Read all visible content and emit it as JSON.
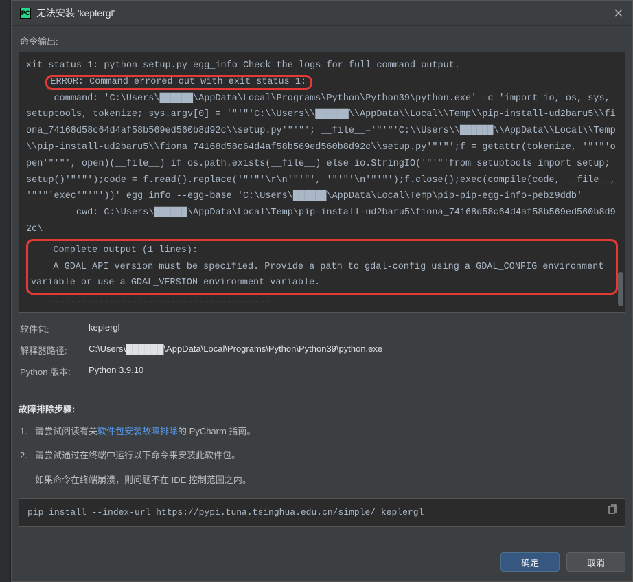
{
  "titlebar": {
    "app_icon_text": "PC",
    "title": "无法安装 'keplergl'"
  },
  "output_label": "命令输出:",
  "cmd": {
    "line1": "xit status 1: python setup.py egg_info Check the logs for full command output.",
    "error_line": "ERROR: Command errored out with exit status 1:",
    "command_block": "     command: 'C:\\Users\\██████\\AppData\\Local\\Programs\\Python\\Python39\\python.exe' -c 'import io, os, sys, setuptools, tokenize; sys.argv[0] = '\"'\"'C:\\\\Users\\\\██████\\\\AppData\\\\Local\\\\Temp\\\\pip-install-ud2baru5\\\\fiona_74168d58c64d4af58b569ed560b8d92c\\\\setup.py'\"'\"'; __file__='\"'\"'C:\\\\Users\\\\██████\\\\AppData\\\\Local\\\\Temp\\\\pip-install-ud2baru5\\\\fiona_74168d58c64d4af58b569ed560b8d92c\\\\setup.py'\"'\"';f = getattr(tokenize, '\"'\"'open'\"'\"', open)(__file__) if os.path.exists(__file__) else io.StringIO('\"'\"'from setuptools import setup; setup()'\"'\"');code = f.read().replace('\"'\"'\\r\\n'\"'\"', '\"'\"'\\n'\"'\"');f.close();exec(compile(code, __file__, '\"'\"'exec'\"'\"'))' egg_info --egg-base 'C:\\Users\\██████\\AppData\\Local\\Temp\\pip-pip-egg-info-pebz9ddb'",
    "cwd_line": "         cwd: C:\\Users\\██████\\AppData\\Local\\Temp\\pip-install-ud2baru5\\fiona_74168d58c64d4af58b569ed560b8d92c\\",
    "complete_output": "    Complete output (1 lines):",
    "gdal_msg": "    A GDAL API version must be specified. Provide a path to gdal-config using a GDAL_CONFIG environment variable or use a GDAL_VERSION environment variable.",
    "dashes": "    ----------------------------------------"
  },
  "info": {
    "package_label": "软件包:",
    "package_value": "keplergl",
    "interpreter_label": "解释器路径:",
    "interpreter_value": "C:\\Users\\██████\\AppData\\Local\\Programs\\Python\\Python39\\python.exe",
    "pyver_label": "Python 版本:",
    "pyver_value": "Python 3.9.10"
  },
  "troubleshoot": {
    "title": "故障排除步骤:",
    "step1_pre": "请尝试阅读有关",
    "step1_link": "软件包安装故障排除",
    "step1_post": "的 PyCharm 指南。",
    "step2": "请尝试通过在终端中运行以下命令来安装此软件包。",
    "step2_sub": "如果命令在终端崩溃，则问题不在 IDE 控制范围之内。"
  },
  "pip_cmd": "pip install --index-url https://pypi.tuna.tsinghua.edu.cn/simple/ keplergl",
  "buttons": {
    "ok": "确定",
    "cancel": "取消"
  }
}
